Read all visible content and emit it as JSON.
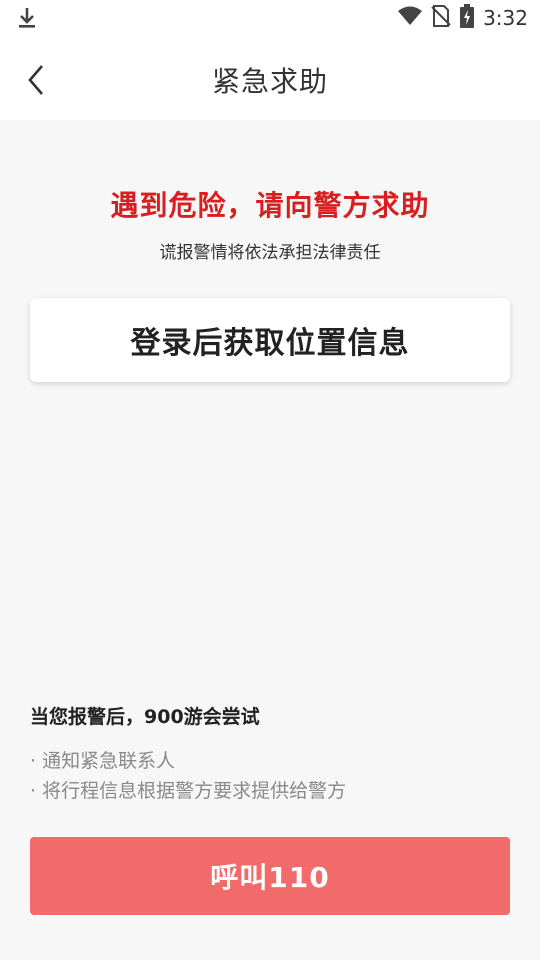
{
  "status_bar": {
    "time": "3:32",
    "icons": [
      "download-icon",
      "wifi-icon",
      "no-sim-icon",
      "battery-charging-icon"
    ]
  },
  "app_bar": {
    "title": "紧急求助",
    "back_icon": "chevron-left-icon"
  },
  "alert": {
    "headline": "遇到危险，请向警方求助",
    "warning": "谎报警情将依法承担法律责任"
  },
  "location_card": {
    "label": "登录后获取位置信息"
  },
  "info": {
    "title": "当您报警后，900游会尝试",
    "items": [
      "· 通知紧急联系人",
      "· 将行程信息根据警方要求提供给警方"
    ]
  },
  "call_button": {
    "label": "呼叫110"
  },
  "colors": {
    "headline_red": "#d81e1e",
    "call_button_bg": "#f26b6b",
    "background": "#f7f7f7"
  }
}
